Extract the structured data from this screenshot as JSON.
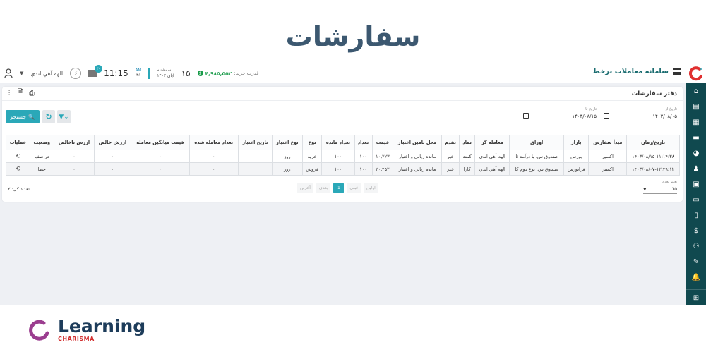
{
  "banner": {
    "title": "سفارشات"
  },
  "topbar": {
    "brand": "سامانه معاملات برخط",
    "user_name": "الهه آهي اندي",
    "notification_count": "۴۹",
    "clock": "11:15",
    "ampm": "AM",
    "seconds": "۳۶",
    "day_number": "۱۵",
    "weekday": "سه‌شنبه",
    "month_year": "آبان ۱۴۰۳",
    "credit_label": "قدرت خريد:",
    "credit_value": "۴,۹۸۵,۵۵۲"
  },
  "sidebar": {
    "items": [
      {
        "icon": "home-icon",
        "glyph": "⌂"
      },
      {
        "icon": "table-icon",
        "glyph": "▤"
      },
      {
        "icon": "document-icon",
        "glyph": "▦"
      },
      {
        "icon": "briefcase-icon",
        "glyph": "▬"
      },
      {
        "icon": "pie-chart-icon",
        "glyph": "◕"
      },
      {
        "icon": "user-book-icon",
        "glyph": "♟"
      },
      {
        "icon": "id-card-icon",
        "glyph": "▣"
      },
      {
        "icon": "credit-card-icon",
        "glyph": "▭"
      },
      {
        "icon": "report-icon",
        "glyph": "▯"
      },
      {
        "icon": "dollar-icon",
        "glyph": "$"
      },
      {
        "icon": "user-plus-icon",
        "glyph": "⚇"
      },
      {
        "icon": "edit-icon",
        "glyph": "✎"
      },
      {
        "icon": "bell-icon",
        "glyph": "🔔"
      }
    ],
    "bottom_icon": {
      "icon": "grid-icon",
      "glyph": "⊞"
    }
  },
  "card": {
    "title": "دفتر سفارشات",
    "date_from": {
      "label": "تاريخ از",
      "value": "۱۴۰۳/۰۸/۰۵"
    },
    "date_to": {
      "label": "تاريخ تا",
      "value": "۱۴۰۳/۰۸/۱۵"
    },
    "search_label": "جستجو",
    "columns": [
      "تاريخ/زمان",
      "مبدأ سفارش",
      "بازار",
      "اوراق",
      "معامله گر",
      "نماد",
      "تقدم",
      "محل تامين اعتبار",
      "قيمت",
      "تعداد",
      "تعداد مانده",
      "نوع",
      "نوع اعتبار",
      "تاريخ اعتبار",
      "تعداد معامله شده",
      "قيمت ميانگين معامله",
      "ارزش خالص",
      "ارزش ناخالص",
      "وضعيت",
      "عمليات"
    ],
    "rows": [
      [
        "۱۴۰۳/۰۸/۱۵-۱۱:۱۴:۳۸",
        "اکسير",
        "بورس",
        "صندوق س. با درآمد ثا",
        "الهه آهي اندي",
        "کمند",
        "خير",
        "مانده ريالي و اعتبار",
        "۱۰,۲۲۳",
        "۱۰۰",
        "۱۰۰",
        "خريد",
        "روز",
        "",
        "۰",
        "۰",
        "۰",
        "۰",
        "در صف"
      ],
      [
        "۱۴۰۳/۰۸/۰۷-۱۲:۴۹:۱۲",
        "اکسير",
        "فرابورس",
        "صندوق س. نوع دوم کا",
        "الهه آهي اندي",
        "کارا",
        "خير",
        "مانده ريالي و اعتبار",
        "۲۰,۴۵۲",
        "۱۰۰",
        "۱۰۰",
        "فروش",
        "روز",
        "",
        "۰",
        "۰",
        "۰",
        "۰",
        "خطا"
      ]
    ],
    "pager": {
      "first": "اولين",
      "prev": "قبلی",
      "current": "1",
      "next": "بعدی",
      "last": "آخرين"
    },
    "total_label": "تعداد کل: ۲",
    "page_size": {
      "label": "تغيير تعداد",
      "value": "۱۵"
    }
  },
  "footer": {
    "brand_word": "Learning",
    "brand_sub": "CHARISMA"
  },
  "colors": {
    "accent": "#2aa8b8",
    "sidebar": "#10494f",
    "title": "#3c5870",
    "credit": "#1a9b4a"
  }
}
